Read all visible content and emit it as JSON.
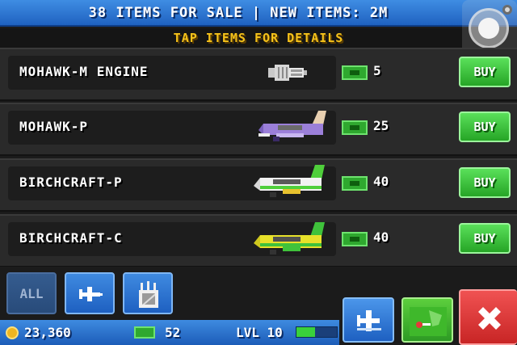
{
  "header": {
    "title": "38 ITEMS FOR SALE | NEW ITEMS: 2M"
  },
  "subheader": {
    "text": "TAP ITEMS FOR DETAILS"
  },
  "items": [
    {
      "name": "MOHAWK-M ENGINE",
      "price": "5",
      "buy_label": "BUY",
      "icon": "engine-icon"
    },
    {
      "name": "MOHAWK-P",
      "price": "25",
      "buy_label": "BUY",
      "icon": "plane-icon"
    },
    {
      "name": "BIRCHCRAFT-P",
      "price": "40",
      "buy_label": "BUY",
      "icon": "plane-icon"
    },
    {
      "name": "BIRCHCRAFT-C",
      "price": "40",
      "buy_label": "BUY",
      "icon": "plane-icon"
    }
  ],
  "filters": {
    "all_label": "ALL"
  },
  "status": {
    "coins": "23,360",
    "cash": "52",
    "level": "LVL 10",
    "xp_progress": 0.45
  },
  "colors": {
    "header_blue": "#2b74d4",
    "title_yellow": "#f5c21a",
    "buy_green": "#3cc43c",
    "close_red": "#e03a3a"
  }
}
